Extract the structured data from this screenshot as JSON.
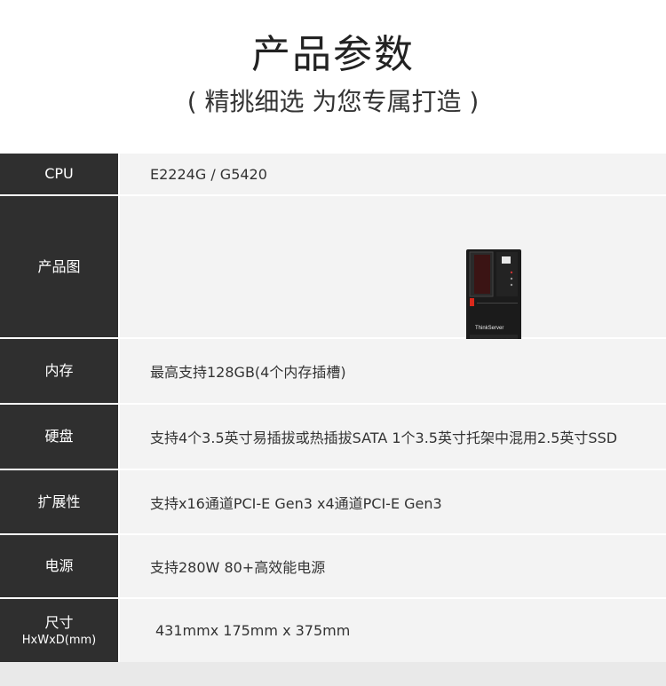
{
  "header": {
    "title": "产品参数",
    "subtitle": "( 精挑细选 为您专属打造 )"
  },
  "specs": {
    "cpu": {
      "label": "CPU",
      "value": "E2224G / G5420"
    },
    "image": {
      "label": "产品图",
      "brand": "ThinkServer"
    },
    "memory": {
      "label": "内存",
      "value": "最高支持128GB(4个内存插槽)"
    },
    "storage": {
      "label": "硬盘",
      "value": "支持4个3.5英寸易插拔或热插拔SATA 1个3.5英寸托架中混用2.5英寸SSD"
    },
    "expansion": {
      "label": "扩展性",
      "value": "支持x16通道PCI-E Gen3  x4通道PCI-E Gen3"
    },
    "power": {
      "label": "电源",
      "value": "支持280W 80+高效能电源"
    },
    "size": {
      "label": "尺寸",
      "sublabel": "HxWxD(mm)",
      "value": "431mmx 175mm x 375mm"
    }
  },
  "colors": {
    "label_bg": "#2f2f2f",
    "value_bg": "#f3f3f3",
    "accent_red": "#d9291c"
  }
}
